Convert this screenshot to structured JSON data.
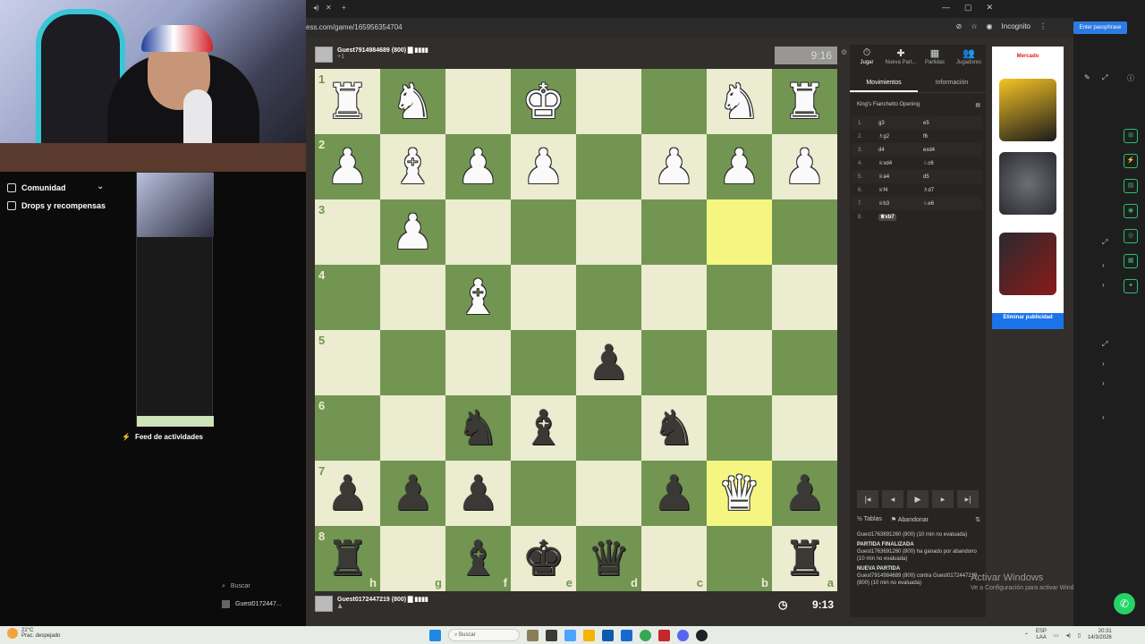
{
  "left_panel": {
    "items": [
      {
        "label": "Comunidad"
      },
      {
        "label": "Drops y recompensas"
      }
    ],
    "feed_label": "Feed de actividades",
    "search_label": "Buscar",
    "guest_label": "Guest0172447..."
  },
  "browser": {
    "url": "ess.com/game/165956354704",
    "mode": "Incognito"
  },
  "top_player": {
    "name": "Guest7914984689",
    "rating": "(800)",
    "sub": "+1"
  },
  "bottom_player": {
    "name": "Guest0172447219",
    "rating": "(800)"
  },
  "clocks": {
    "top": "9:16",
    "bottom": "9:13"
  },
  "board": {
    "orientation": "black",
    "rank_labels": [
      "1",
      "2",
      "3",
      "4",
      "5",
      "6",
      "7",
      "8"
    ],
    "file_labels": [
      "h",
      "g",
      "f",
      "e",
      "d",
      "c",
      "b",
      "a"
    ],
    "highlight_squares": [
      "2,6",
      "6,6"
    ],
    "pieces": [
      [
        "wR",
        "wN",
        "",
        "wK",
        "",
        "",
        "wN",
        "wR"
      ],
      [
        "wP",
        "wB",
        "wP",
        "wP",
        "",
        "wP",
        "wP",
        "wP"
      ],
      [
        "",
        "wP",
        "",
        "",
        "",
        "",
        "",
        ""
      ],
      [
        "",
        "",
        "wB",
        "",
        "",
        "",
        "",
        ""
      ],
      [
        "",
        "",
        "",
        "",
        "bP",
        "",
        "",
        ""
      ],
      [
        "",
        "",
        "bN",
        "bB",
        "",
        "bN",
        "",
        ""
      ],
      [
        "bP",
        "bP",
        "bP",
        "",
        "",
        "bP",
        "wQ",
        "bP"
      ],
      [
        "bR",
        "",
        "bB",
        "bK",
        "bQ",
        "",
        "",
        "bR"
      ]
    ]
  },
  "sidebar": {
    "tabs": [
      {
        "icon": "⏱",
        "label": "Jugar"
      },
      {
        "icon": "✚",
        "label": "Nueva Part..."
      },
      {
        "icon": "▦",
        "label": "Partidas"
      },
      {
        "icon": "👥",
        "label": "Jugadores"
      }
    ],
    "subtabs": [
      "Movimientos",
      "Información"
    ],
    "opening": "King's Fianchetto Opening",
    "moves": [
      {
        "n": "1.",
        "w": "g3",
        "b": "e5"
      },
      {
        "n": "2.",
        "w": "♗g2",
        "b": "f6"
      },
      {
        "n": "3.",
        "w": "d4",
        "b": "exd4"
      },
      {
        "n": "4.",
        "w": "♕xd4",
        "b": "♘c6"
      },
      {
        "n": "5.",
        "w": "♕a4",
        "b": "d5"
      },
      {
        "n": "6.",
        "w": "♕f4",
        "b": "♗d7"
      },
      {
        "n": "7.",
        "w": "♕b3",
        "b": "♘e6"
      },
      {
        "n": "8.",
        "w": "♕xb7",
        "b": ""
      }
    ],
    "actions": {
      "tables": "Tablas",
      "resign": "Abandonar"
    },
    "chat": [
      {
        "title": "",
        "text": "Guest1763691260 (800) (10 min no evaluada)"
      },
      {
        "title": "PARTIDA FINALIZADA",
        "text": "Guest1763691260 (800) ha ganado por abandono (10 min no evaluada)"
      },
      {
        "title": "NUEVA PARTIDA",
        "text": "Guest7914984689 (800) contra Guest0172447219 (800) (10 min no evaluada)"
      }
    ]
  },
  "ad": {
    "brand": "Mercado",
    "button": "Eliminar publicidad"
  },
  "windows": {
    "activate_title": "Activar Windows",
    "activate_sub": "Ve a Configuración para activar Windows."
  },
  "right_strip": {
    "passphrase": "Enter passphrase"
  },
  "taskbar": {
    "temp": "22°C",
    "weather": "Prac. despejado",
    "search": "Buscar",
    "lang_1": "ESP",
    "lang_2": "LAA",
    "time": "20:31",
    "date": "14/3/2026"
  }
}
